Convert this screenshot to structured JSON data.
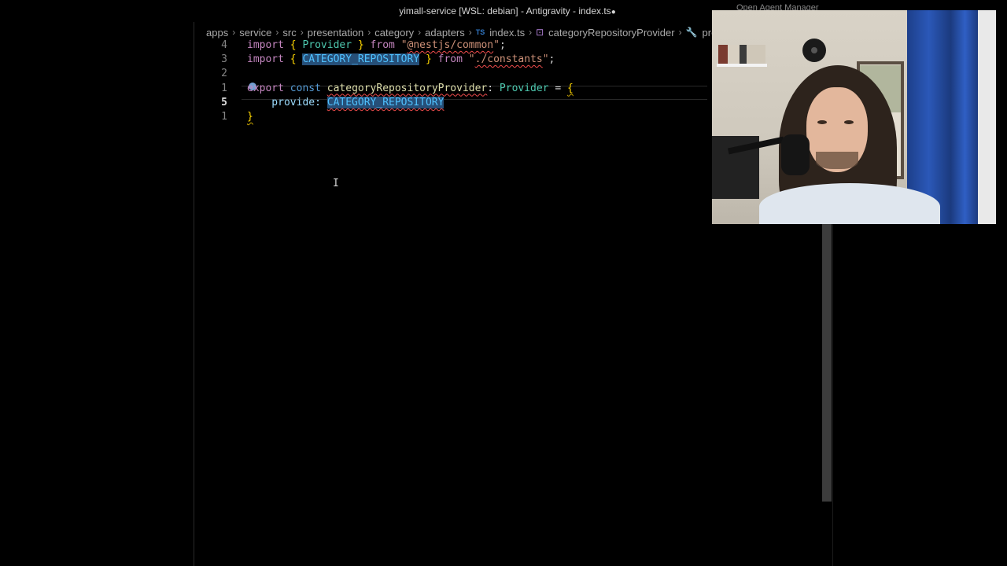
{
  "window": {
    "title": "yimall-service [WSL: debian] - Antigravity - index.ts",
    "dirty_marker": "●",
    "top_right_label": "Open Agent Manager"
  },
  "breadcrumb": {
    "items": [
      "apps",
      "service",
      "src",
      "presentation",
      "category",
      "adapters"
    ],
    "file_icon": "TS",
    "file": "index.ts",
    "symbol_icon": "symbol-variable-icon",
    "symbol": "categoryRepositoryProvider",
    "property_icon": "wrench-icon",
    "property": "prov"
  },
  "editor": {
    "lines": [
      {
        "num": "4",
        "active": false,
        "tokens": [
          {
            "t": "import",
            "c": "kw"
          },
          {
            "t": " ",
            "c": "plain"
          },
          {
            "t": "{",
            "c": "br"
          },
          {
            "t": " Provider ",
            "c": "ty"
          },
          {
            "t": "}",
            "c": "br"
          },
          {
            "t": " from ",
            "c": "kw"
          },
          {
            "t": "\"",
            "c": "str"
          },
          {
            "t": "@nestjs/common",
            "c": "str squiggle"
          },
          {
            "t": "\"",
            "c": "str"
          },
          {
            "t": ";",
            "c": "plain"
          }
        ]
      },
      {
        "num": "3",
        "active": false,
        "tokens": [
          {
            "t": "import",
            "c": "kw"
          },
          {
            "t": " ",
            "c": "plain"
          },
          {
            "t": "{",
            "c": "br"
          },
          {
            "t": " ",
            "c": "plain"
          },
          {
            "t": "CATEGORY_REPOSITORY",
            "c": "var sel"
          },
          {
            "t": " ",
            "c": "plain"
          },
          {
            "t": "}",
            "c": "br"
          },
          {
            "t": " from ",
            "c": "kw"
          },
          {
            "t": "\"",
            "c": "str"
          },
          {
            "t": "./constants",
            "c": "str squiggle"
          },
          {
            "t": "\"",
            "c": "str"
          },
          {
            "t": ";",
            "c": "plain"
          }
        ]
      },
      {
        "num": "2",
        "active": false,
        "tokens": []
      },
      {
        "num": "1",
        "active": false,
        "tokens": [
          {
            "t": "export",
            "c": "kw"
          },
          {
            "t": " const ",
            "c": "kw-blue"
          },
          {
            "t": "categoryRepositoryProvider",
            "c": "fn squiggle"
          },
          {
            "t": ": ",
            "c": "plain"
          },
          {
            "t": "Provider",
            "c": "ty"
          },
          {
            "t": " = ",
            "c": "plain"
          },
          {
            "t": "{",
            "c": "br squiggle-y"
          }
        ]
      },
      {
        "num": "5",
        "active": true,
        "tokens": [
          {
            "t": "    provide: ",
            "c": "prop"
          },
          {
            "t": "CATEGORY_REPOSITORY",
            "c": "var sel squiggle"
          }
        ]
      },
      {
        "num": "1",
        "active": false,
        "tokens": [
          {
            "t": "}",
            "c": "br squiggle-y"
          }
        ]
      }
    ]
  }
}
